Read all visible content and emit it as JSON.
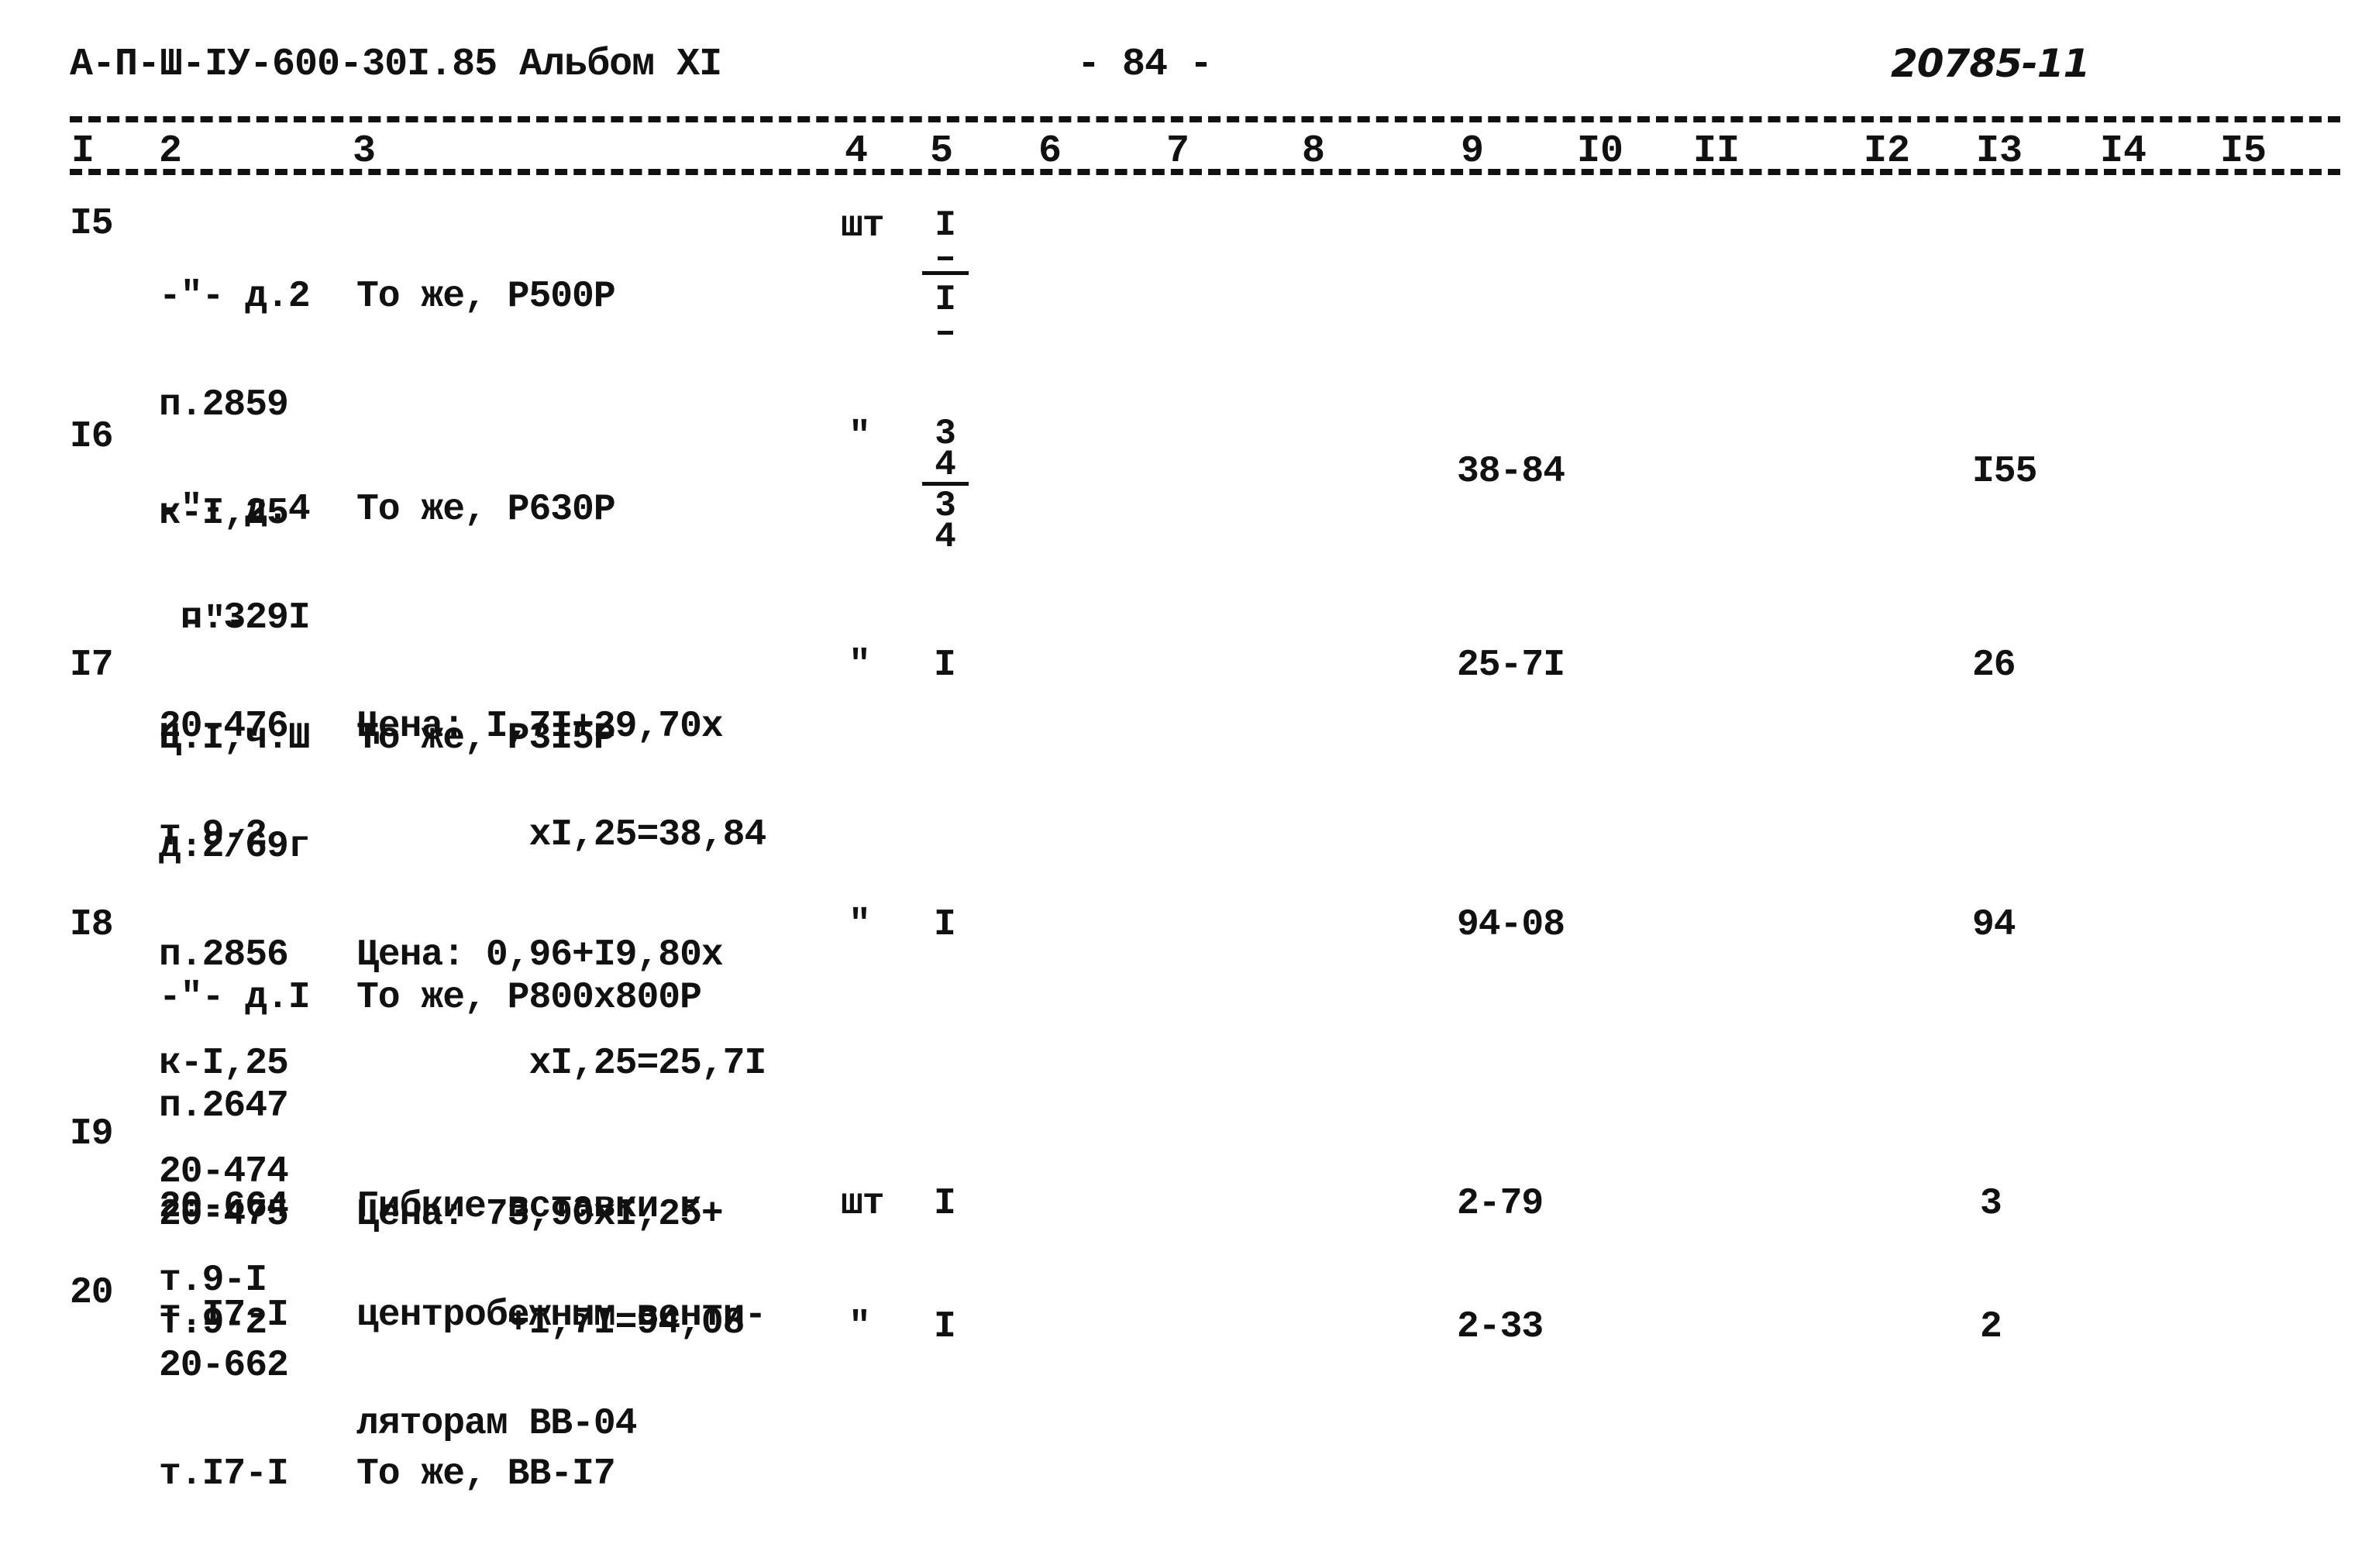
{
  "header": {
    "doc_code": "А-П-Ш-ІУ-600-30І.85 Альбом ХІ",
    "page_number": "- 84 -",
    "stamp": "20785-11"
  },
  "columns": [
    "І",
    "2",
    "3",
    "4",
    "5",
    "6",
    "7",
    "8",
    "9",
    "І0",
    "ІІ",
    "І2",
    "І3",
    "І4",
    "І5"
  ],
  "rows": [
    {
      "num": "І5",
      "ref": [
        "-\"- д.2",
        "п.2859",
        "к-І,25",
        "-\"-"
      ],
      "desc": [
        "То же, Р500Р"
      ],
      "unit": "шт",
      "qty": {
        "top": "І",
        "top2": "-",
        "bottom": "І",
        "bottom2": "-"
      },
      "col9": "",
      "col13": ""
    },
    {
      "num": "І6",
      "ref": [
        "-\"- д.4",
        " п.329І",
        "20-476",
        "т.9-2"
      ],
      "desc": [
        "То же, Р630Р",
        "",
        "Цена: І,7І+29,70х",
        "        хІ,25=38,84"
      ],
      "unit": "\"",
      "qty": {
        "top": "3",
        "top2": "4",
        "bottom": "3",
        "bottom2": "4"
      },
      "col9": "38-84",
      "col13": "І55"
    },
    {
      "num": "І7",
      "ref": [
        "Ц.І,ч.Ш",
        "д.2/69г",
        "п.2856",
        "к-І,25",
        "20-474",
        "т.9-І"
      ],
      "desc": [
        "То же, Р3І5Р",
        "",
        "Цена: 0,96+І9,80х",
        "        хІ,25=25,7І"
      ],
      "unit": "\"",
      "qty": {
        "single": "І"
      },
      "col9": "25-7І",
      "col13": "26"
    },
    {
      "num": "І8",
      "ref": [
        "-\"- д.І",
        "п.2647",
        "20-475",
        "т.9-2"
      ],
      "desc": [
        "То же, Р800х800Р",
        "",
        "Цена: 73,90хІ,25+",
        "       +І,7І=94,08"
      ],
      "unit": "\"",
      "qty": {
        "single": "І"
      },
      "col9": "94-08",
      "col13": "94"
    },
    {
      "num": "І9",
      "ref": [
        "20-664",
        "т.І7-І"
      ],
      "desc": [
        "Гибкие вставки к",
        "центробежным венти-",
        "ляторам ВВ-04"
      ],
      "unit": "шт",
      "qty": {
        "single": "І"
      },
      "col9": "2-79",
      "col13": "3"
    },
    {
      "num": "20",
      "ref": [
        "20-662",
        "т.І7-І"
      ],
      "desc": [
        "",
        "То же, ВВ-І7"
      ],
      "unit": "\"",
      "qty": {
        "single": "І"
      },
      "col9": "2-33",
      "col13": "2"
    }
  ]
}
